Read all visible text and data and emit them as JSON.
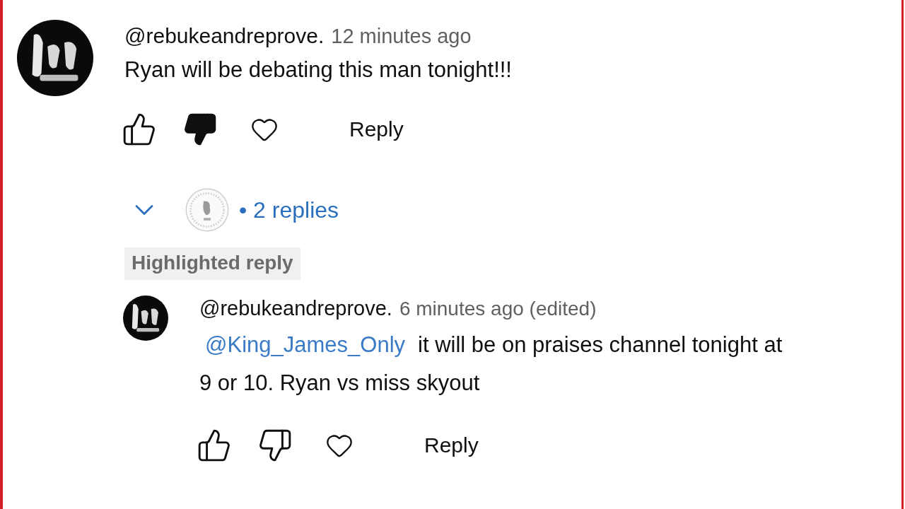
{
  "comment": {
    "author": "@rebukeandreprove.",
    "time": "12 minutes ago",
    "text": "Ryan will be debating this man tonight!!!",
    "liked": false,
    "disliked": true,
    "hearted": false,
    "reply_button": "Reply"
  },
  "replies_toggle": {
    "expanded": false,
    "separator": "•",
    "label": "2 replies"
  },
  "highlight_badge": "Highlighted reply",
  "reply": {
    "author": "@rebukeandreprove.",
    "time": "6 minutes ago (edited)",
    "mention": "@King_James_Only",
    "text": "it will be on praises channel tonight at 9 or 10. Ryan vs miss skyout",
    "liked": false,
    "disliked": false,
    "hearted": false,
    "reply_button": "Reply"
  }
}
